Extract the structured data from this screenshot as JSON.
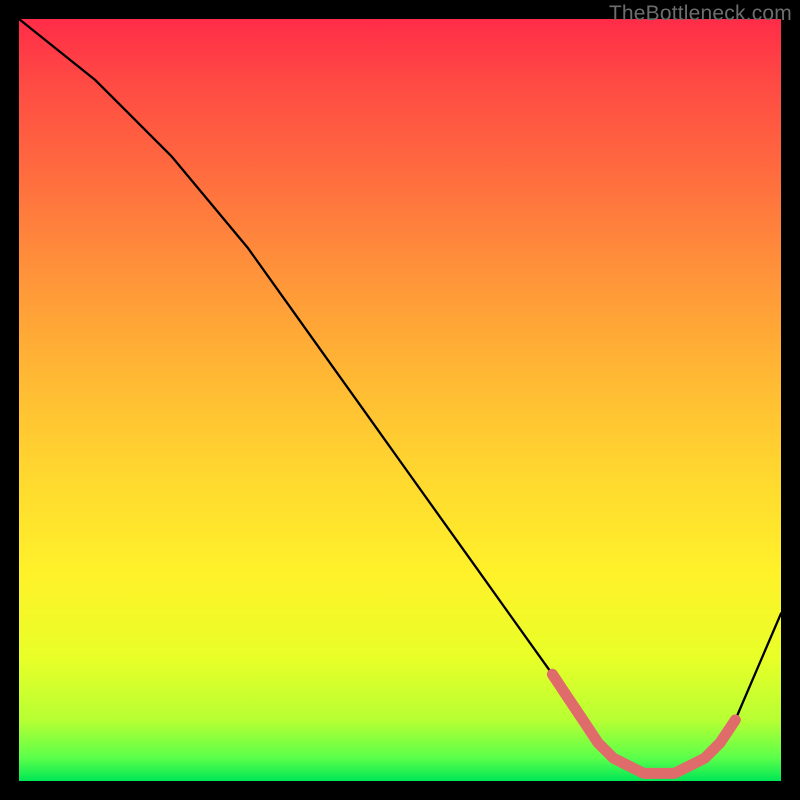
{
  "watermark": "TheBottleneck.com",
  "colors": {
    "frame_bg": "#000000",
    "curve_stroke": "#000000",
    "accent_stroke": "#e06b6b",
    "gradient_top": "#ff2c48",
    "gradient_bottom": "#00e756"
  },
  "chart_data": {
    "type": "line",
    "title": "",
    "xlabel": "",
    "ylabel": "",
    "xlim": [
      0,
      100
    ],
    "ylim": [
      0,
      100
    ],
    "grid": false,
    "legend": false,
    "series": [
      {
        "name": "curve",
        "x": [
          0,
          5,
          10,
          15,
          20,
          25,
          30,
          35,
          40,
          45,
          50,
          55,
          60,
          65,
          70,
          74,
          78,
          82,
          86,
          90,
          94,
          100
        ],
        "values": [
          100,
          96,
          92,
          87,
          82,
          76,
          70,
          63,
          56,
          49,
          42,
          35,
          28,
          21,
          14,
          8,
          3,
          1,
          1,
          3,
          8,
          22
        ]
      }
    ],
    "highlight": {
      "x": [
        70,
        72,
        74,
        76,
        78,
        80,
        82,
        84,
        86,
        88,
        90,
        92,
        94
      ],
      "values": [
        14,
        11,
        8,
        5,
        3,
        2,
        1,
        1,
        1,
        2,
        3,
        5,
        8
      ]
    }
  }
}
